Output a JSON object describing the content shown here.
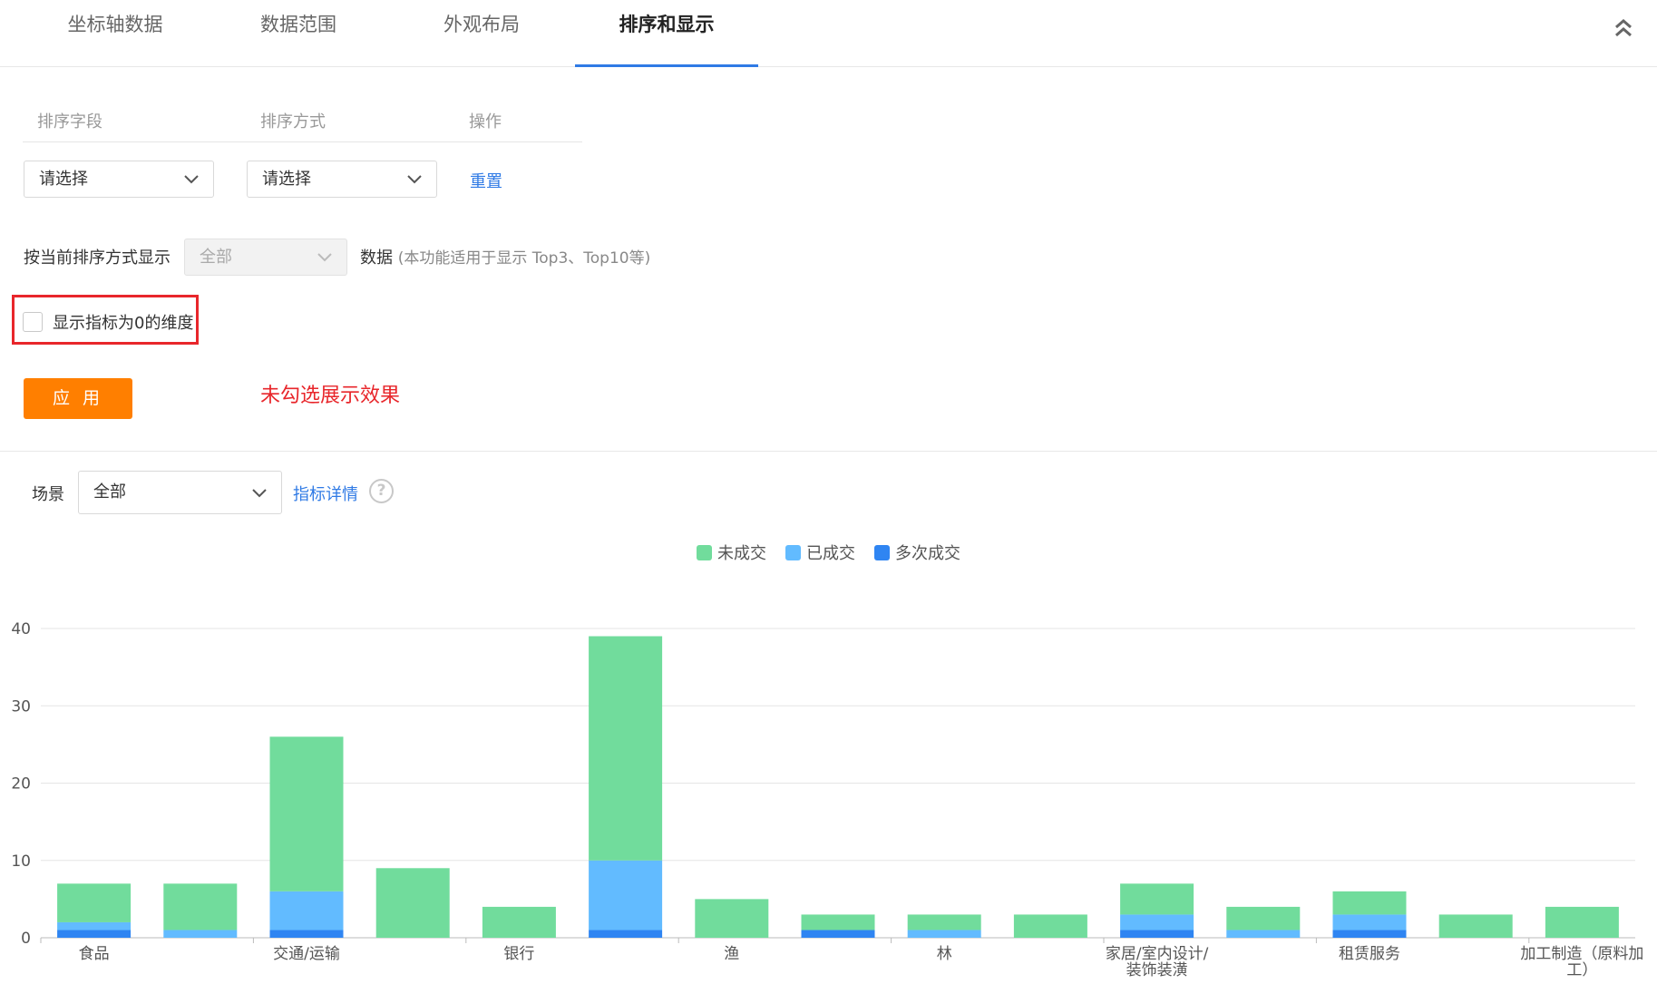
{
  "tabs": [
    {
      "label": "坐标轴数据"
    },
    {
      "label": "数据范围"
    },
    {
      "label": "外观布局"
    },
    {
      "label": "排序和显示",
      "active": true
    }
  ],
  "sort": {
    "field_header": "排序字段",
    "method_header": "排序方式",
    "action_header": "操作",
    "field_select": "请选择",
    "method_select": "请选择",
    "reset_label": "重置"
  },
  "display": {
    "prefix": "按当前排序方式显示",
    "select_value": "全部",
    "suffix": "数据",
    "note": "(本功能适用于显示 Top3、Top10等)"
  },
  "zero_dimension": {
    "label": "显示指标为0的维度",
    "checked": false
  },
  "apply_label": "应 用",
  "annotation": "未勾选展示效果",
  "scene": {
    "label": "场景",
    "value": "全部",
    "detail_link": "指标详情",
    "help_icon": "?"
  },
  "colors": {
    "accent": "#2f7ae5",
    "apply": "#ff7f00",
    "highlight": "#e8262b",
    "series_unclosed": "#71dc9c",
    "series_closed": "#62bbff",
    "series_multi": "#2f85f2"
  },
  "chart_data": {
    "type": "bar",
    "stacked": true,
    "categories": [
      "食品",
      "",
      "交通/运输",
      "",
      "银行",
      "",
      "渔",
      "",
      "林",
      "",
      "家居/室内设计/装饰装潢",
      "",
      "租赁服务",
      "",
      "加工制造（原料加工）"
    ],
    "series": [
      {
        "name": "多次成交",
        "color": "#2f85f2",
        "values": [
          1,
          0,
          1,
          0,
          0,
          1,
          0,
          1,
          0,
          0,
          1,
          0,
          1,
          0,
          0
        ]
      },
      {
        "name": "已成交",
        "color": "#62bbff",
        "values": [
          1,
          1,
          5,
          0,
          0,
          9,
          0,
          0,
          1,
          0,
          2,
          1,
          2,
          0,
          0
        ]
      },
      {
        "name": "未成交",
        "color": "#71dc9c",
        "values": [
          5,
          6,
          20,
          9,
          4,
          29,
          5,
          2,
          2,
          3,
          4,
          3,
          3,
          3,
          4
        ]
      }
    ],
    "tick_labels": [
      "食品",
      "交通/运输",
      "银行",
      "渔",
      "林",
      "家居/室内设计/装饰装潢",
      "租赁服务",
      "加工制造（原料加工）"
    ],
    "ylim": [
      0,
      40
    ],
    "yticks": [
      0,
      10,
      20,
      30,
      40
    ],
    "grid": true,
    "legend_position": "top-center"
  }
}
